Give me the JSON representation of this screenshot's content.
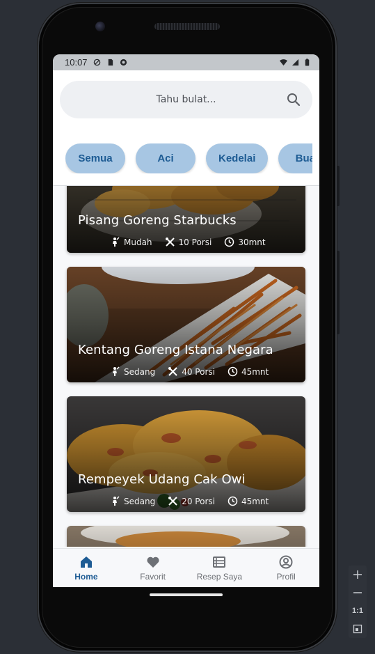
{
  "statusbar": {
    "time": "10:07"
  },
  "search": {
    "placeholder": "Tahu bulat..."
  },
  "chips": [
    "Semua",
    "Aci",
    "Kedelai",
    "Buah"
  ],
  "recipes": [
    {
      "title": "Pisang Goreng Starbucks",
      "difficulty": "Mudah",
      "portion": "10 Porsi",
      "time": "30mnt"
    },
    {
      "title": "Kentang Goreng Istana Negara",
      "difficulty": "Sedang",
      "portion": "40 Porsi",
      "time": "45mnt"
    },
    {
      "title": "Rempeyek Udang Cak Owi",
      "difficulty": "Sedang",
      "portion": "20 Porsi",
      "time": "45mnt"
    }
  ],
  "nav": [
    {
      "label": "Home",
      "icon": "home-icon",
      "active": true
    },
    {
      "label": "Favorit",
      "icon": "heart-icon",
      "active": false
    },
    {
      "label": "Resep Saya",
      "icon": "list-icon",
      "active": false
    },
    {
      "label": "Profil",
      "icon": "profile-icon",
      "active": false
    }
  ],
  "zoom_panel": {
    "ratio_label": "1:1"
  },
  "colors": {
    "accent": "#1e5c94",
    "chip_bg": "#a7c6e3"
  }
}
